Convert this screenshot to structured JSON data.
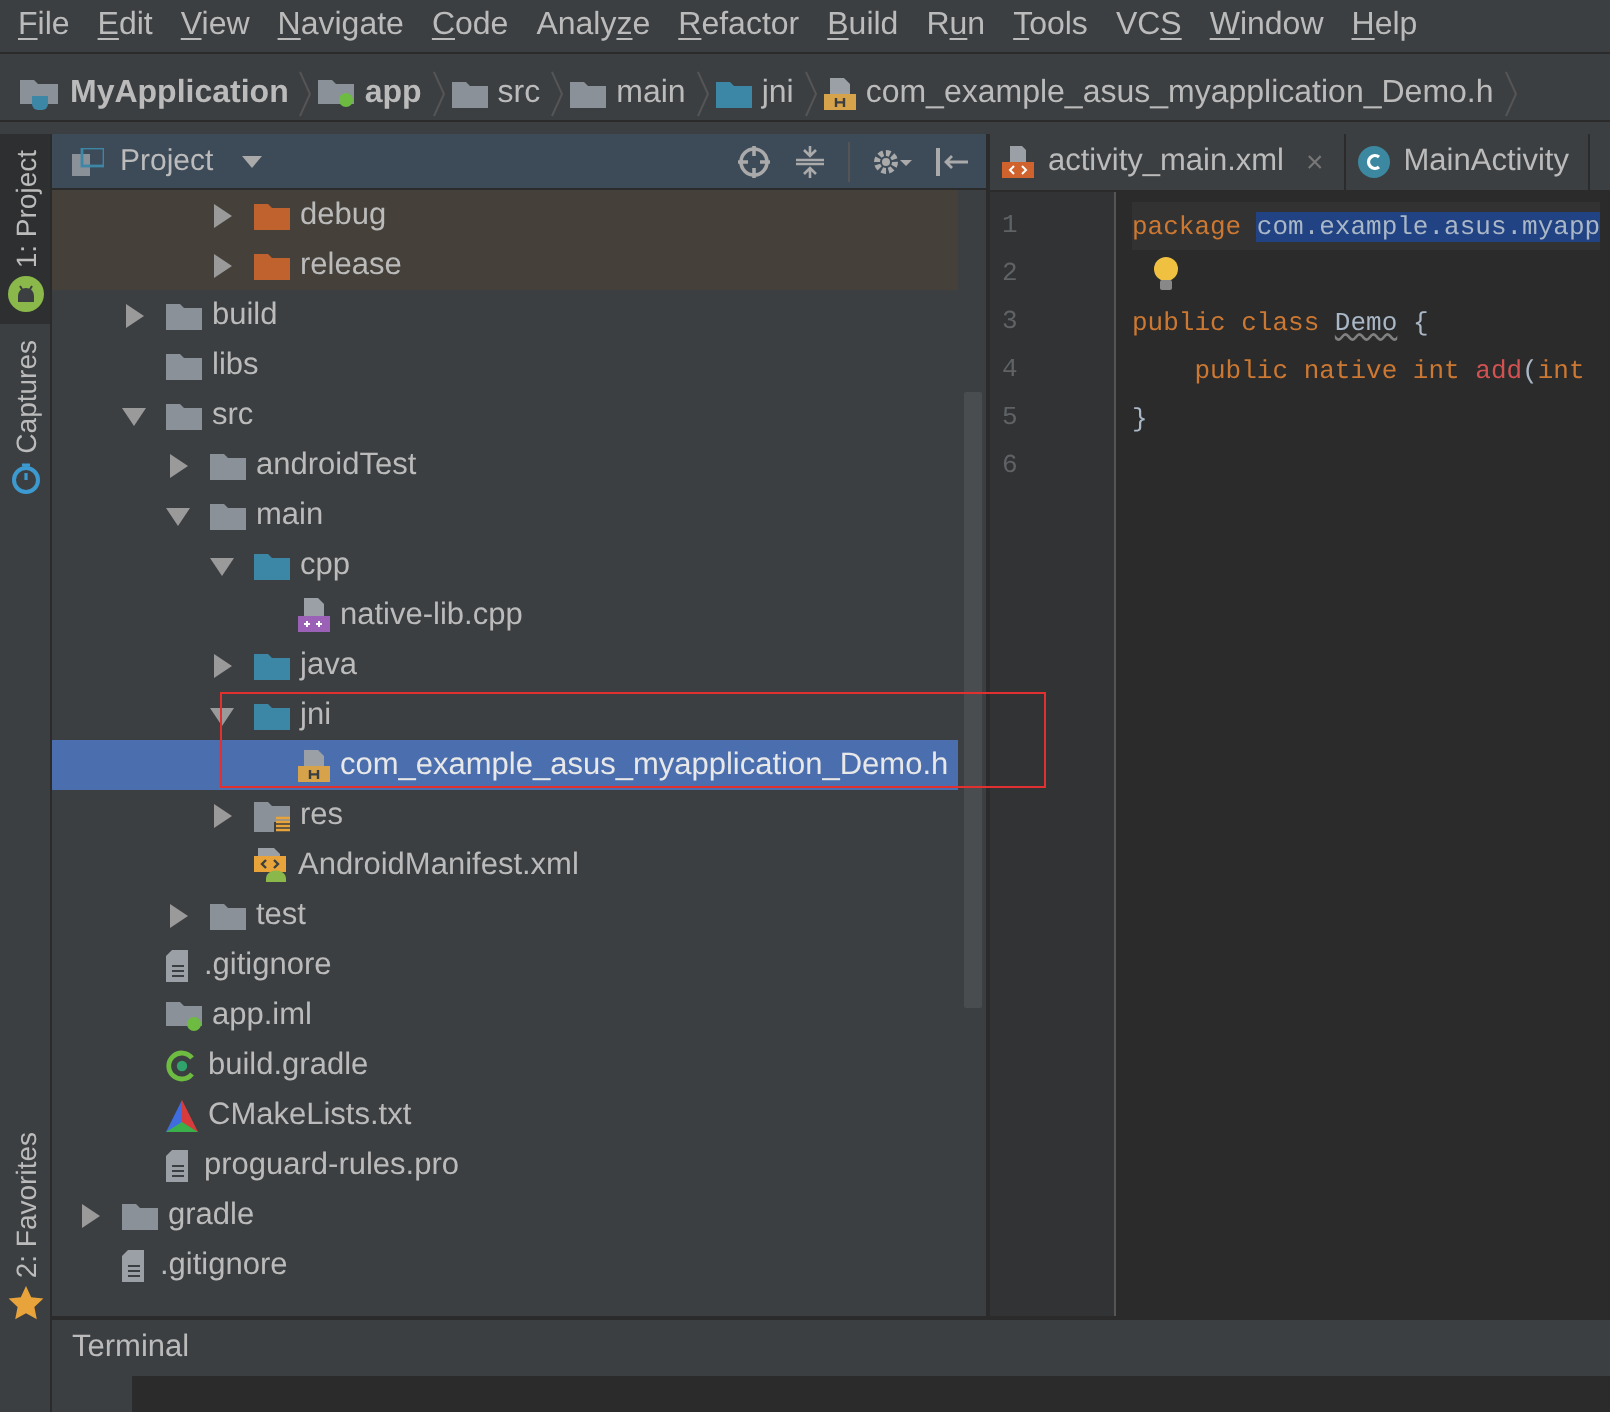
{
  "menu": [
    {
      "key": "F",
      "after": "ile"
    },
    {
      "key": "E",
      "after": "dit"
    },
    {
      "key": "V",
      "after": "iew"
    },
    {
      "key": "N",
      "after": "avigate"
    },
    {
      "key": "C",
      "after": "ode"
    },
    {
      "before": "Analy",
      "key": "z",
      "after": "e"
    },
    {
      "key": "R",
      "after": "efactor"
    },
    {
      "key": "B",
      "after": "uild"
    },
    {
      "before": "R",
      "key": "u",
      "after": "n"
    },
    {
      "key": "T",
      "after": "ools"
    },
    {
      "before": "VC",
      "key": "S"
    },
    {
      "key": "W",
      "after": "indow"
    },
    {
      "key": "H",
      "after": "elp"
    }
  ],
  "breadcrumb": [
    {
      "label": "MyApplication",
      "kind": "project"
    },
    {
      "label": "app",
      "kind": "module"
    },
    {
      "label": "src",
      "kind": "folder"
    },
    {
      "label": "main",
      "kind": "folder"
    },
    {
      "label": "jni",
      "kind": "folder-source"
    },
    {
      "label": "com_example_asus_myapplication_Demo.h",
      "kind": "file-h"
    }
  ],
  "tool_strip": {
    "top": [
      {
        "label": "1: Project",
        "selected": true,
        "kind": "android"
      },
      {
        "label": "Captures",
        "selected": false,
        "kind": "captures"
      }
    ],
    "bottom": [
      {
        "label": "2: Favorites",
        "selected": false,
        "kind": "star"
      }
    ]
  },
  "project_panel": {
    "title": "Project",
    "tree": [
      {
        "children": [
          {
            "children": [
              {
                "children": [
                  {
                    "label": "debug",
                    "kind": "folder-generated",
                    "expanded": false
                  },
                  {
                    "label": "release",
                    "kind": "folder-generated",
                    "expanded": false
                  }
                ]
              }
            ]
          },
          {
            "label": "build",
            "kind": "folder",
            "expanded": false
          },
          {
            "label": "libs",
            "kind": "folder"
          },
          {
            "label": "src",
            "kind": "folder",
            "expanded": true,
            "children": [
              {
                "label": "androidTest",
                "kind": "folder",
                "expanded": false
              },
              {
                "label": "main",
                "kind": "folder",
                "expanded": true,
                "children": [
                  {
                    "label": "cpp",
                    "kind": "folder-source",
                    "expanded": true,
                    "children": [
                      {
                        "label": "native-lib.cpp",
                        "kind": "file-cpp",
                        "selected": false
                      }
                    ]
                  },
                  {
                    "label": "java",
                    "kind": "folder-source",
                    "expanded": false
                  },
                  {
                    "label": "jni",
                    "kind": "folder-source",
                    "expanded": true,
                    "boxed": true,
                    "children": [
                      {
                        "label": "com_example_asus_myapplication_Demo.h",
                        "kind": "file-h",
                        "selected": true
                      }
                    ]
                  },
                  {
                    "label": "res",
                    "kind": "folder-res",
                    "expanded": false
                  },
                  {
                    "label": "AndroidManifest.xml",
                    "kind": "file-manifest",
                    "selected": false
                  }
                ]
              },
              {
                "label": "test",
                "kind": "folder",
                "expanded": false
              }
            ]
          },
          {
            "label": ".gitignore",
            "kind": "file-text",
            "selected": false
          },
          {
            "label": "app.iml",
            "kind": "file-module",
            "selected": false
          },
          {
            "label": "build.gradle",
            "kind": "file-gradle",
            "selected": false
          },
          {
            "label": "CMakeLists.txt",
            "kind": "file-cmake",
            "selected": false
          },
          {
            "label": "proguard-rules.pro",
            "kind": "file-text",
            "selected": false
          }
        ]
      },
      {
        "label": "gradle",
        "kind": "folder",
        "expanded": false
      },
      {
        "label": ".gitignore",
        "kind": "file-text",
        "selected": false
      }
    ]
  },
  "editor": {
    "tabs": [
      {
        "label": "activity_main.xml",
        "kind": "xml",
        "selected": false,
        "close": "×"
      },
      {
        "label": "MainActivity",
        "kind": "class",
        "selected": false
      }
    ],
    "lines": [
      {
        "number": "1",
        "tokens": [
          {
            "text": "package ",
            "kind": "keyword"
          },
          {
            "text": "com.example.asus.myapp",
            "kind": "selected"
          }
        ]
      },
      {
        "number": "2",
        "bulb": true
      },
      {
        "number": "3",
        "tokens": [
          {
            "text": "public class ",
            "kind": "keyword"
          },
          {
            "text": "Demo",
            "kind": "warning"
          },
          {
            "text": " {",
            "kind": "plain"
          }
        ]
      },
      {
        "number": "4",
        "tokens": [
          {
            "text": "    public native int ",
            "kind": "keyword"
          },
          {
            "text": "add",
            "kind": "error"
          },
          {
            "text": "(",
            "kind": "plain"
          },
          {
            "text": "int",
            "kind": "keyword"
          }
        ]
      },
      {
        "number": "5",
        "tokens": [
          {
            "text": "}",
            "kind": "plain"
          }
        ]
      },
      {
        "number": "6"
      }
    ]
  },
  "bottom_bar": {
    "title": "Terminal"
  }
}
